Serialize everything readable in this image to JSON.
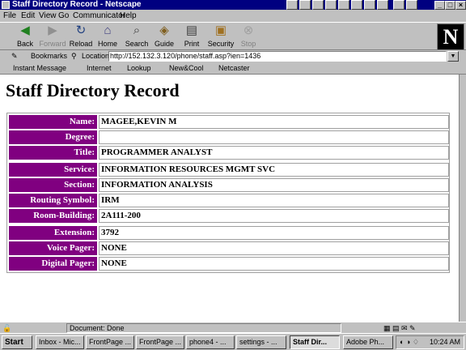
{
  "window": {
    "title": "Staff Directory Record - Netscape"
  },
  "menu": [
    "File",
    "Edit",
    "View",
    "Go",
    "Communicator",
    "Help"
  ],
  "toolbar": {
    "buttons": [
      {
        "label": "Back",
        "icon": "back-arrow-icon"
      },
      {
        "label": "Forward",
        "icon": "forward-arrow-icon"
      },
      {
        "label": "Reload",
        "icon": "reload-icon"
      },
      {
        "label": "Home",
        "icon": "home-icon"
      },
      {
        "label": "Search",
        "icon": "search-icon"
      },
      {
        "label": "Guide",
        "icon": "guide-icon"
      },
      {
        "label": "Print",
        "icon": "print-icon"
      },
      {
        "label": "Security",
        "icon": "lock-icon"
      },
      {
        "label": "Stop",
        "icon": "stop-icon"
      }
    ],
    "logo": "N"
  },
  "location": {
    "bookmarks_label": "Bookmarks",
    "location_label": "Location:",
    "url": "http://152.132.3.120/phone/staff.asp?ien=1436"
  },
  "personal_toolbar": [
    "Instant Message",
    "Internet",
    "Lookup",
    "New&Cool",
    "Netcaster"
  ],
  "page": {
    "heading": "Staff Directory Record",
    "rows": [
      {
        "label": "Name:",
        "value": "MAGEE,KEVIN M"
      },
      {
        "label": "Degree:",
        "value": ""
      },
      {
        "label": "Title:",
        "value": "PROGRAMMER ANALYST"
      },
      {
        "label": "Service:",
        "value": "INFORMATION RESOURCES MGMT SVC"
      },
      {
        "label": "Section:",
        "value": "INFORMATION ANALYSIS"
      },
      {
        "label": "Routing Symbol:",
        "value": "IRM"
      },
      {
        "label": "Room-Building:",
        "value": "2A111-200"
      },
      {
        "label": "Extension:",
        "value": "3792"
      },
      {
        "label": "Voice Pager:",
        "value": "NONE"
      },
      {
        "label": "Digital Pager:",
        "value": "NONE"
      }
    ]
  },
  "status": {
    "text": "Document: Done"
  },
  "taskbar": {
    "start": "Start",
    "tasks": [
      "Inbox - Mic...",
      "FrontPage ...",
      "FrontPage ...",
      "phone4 - ...",
      "settings - ...",
      "Staff Dir...",
      "Adobe Ph..."
    ],
    "clock": "10:24 AM"
  }
}
